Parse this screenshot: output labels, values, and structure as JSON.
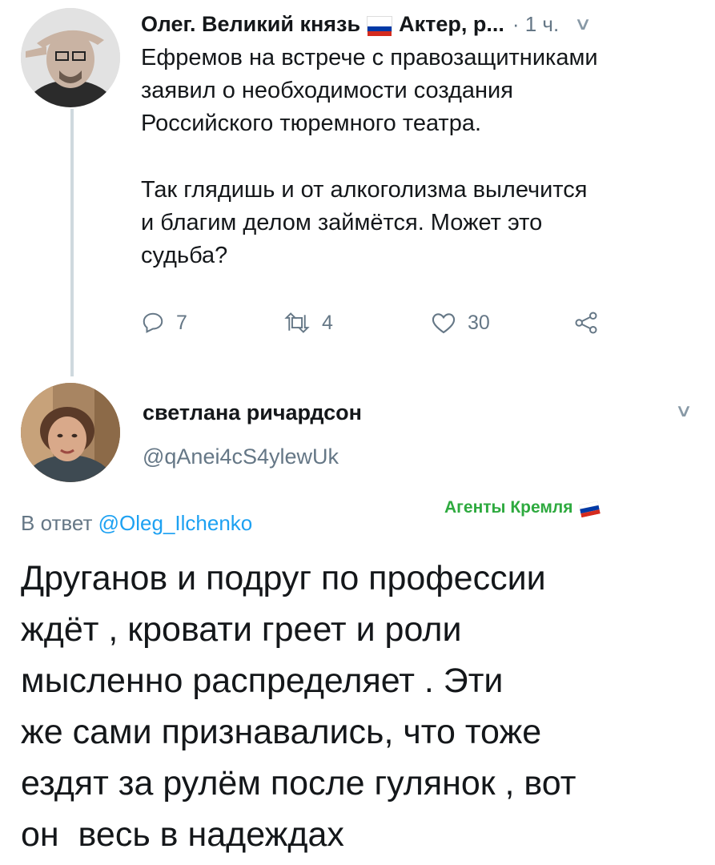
{
  "tweet1": {
    "author_name": "Олег. Великий князь",
    "author_tail": "Актер, р...",
    "time": "· 1 ч.",
    "body_lines": [
      "Ефремов на встрече с правозащитниками",
      "заявил о необходимости создания",
      "Российского тюремного театра.",
      "Так глядишь и от алкоголизма вылечится",
      "и благим делом займётся. Может это",
      "судьба?"
    ],
    "replies_count": "7",
    "retweets_count": "4",
    "likes_count": "30"
  },
  "tweet2": {
    "author_name": "светлана ричардсон",
    "handle": "@qAnei4cS4ylewUk",
    "reply_prefix": "В ответ",
    "reply_to": "@Oleg_Ilchenko",
    "body_lines": [
      "Друганов и подруг по профессии",
      "ждёт , кровати греет и роли",
      "мысленно распределяет . Эти",
      "же сами признавались, что тоже",
      "ездят за рулём после гулянок , вот",
      "он  весь в надеждах"
    ]
  },
  "watermark": "Агенты Кремля",
  "icons": {
    "reply": "reply-icon",
    "retweet": "retweet-icon",
    "like": "heart-icon",
    "share": "share-icon",
    "menu": "chevron-down-icon",
    "flag": "russian-flag-icon"
  },
  "colors": {
    "text": "#14171a",
    "secondary": "#657786",
    "link": "#1da1f2",
    "thread_line": "#cfd9de",
    "watermark": "#2eaa3f"
  }
}
